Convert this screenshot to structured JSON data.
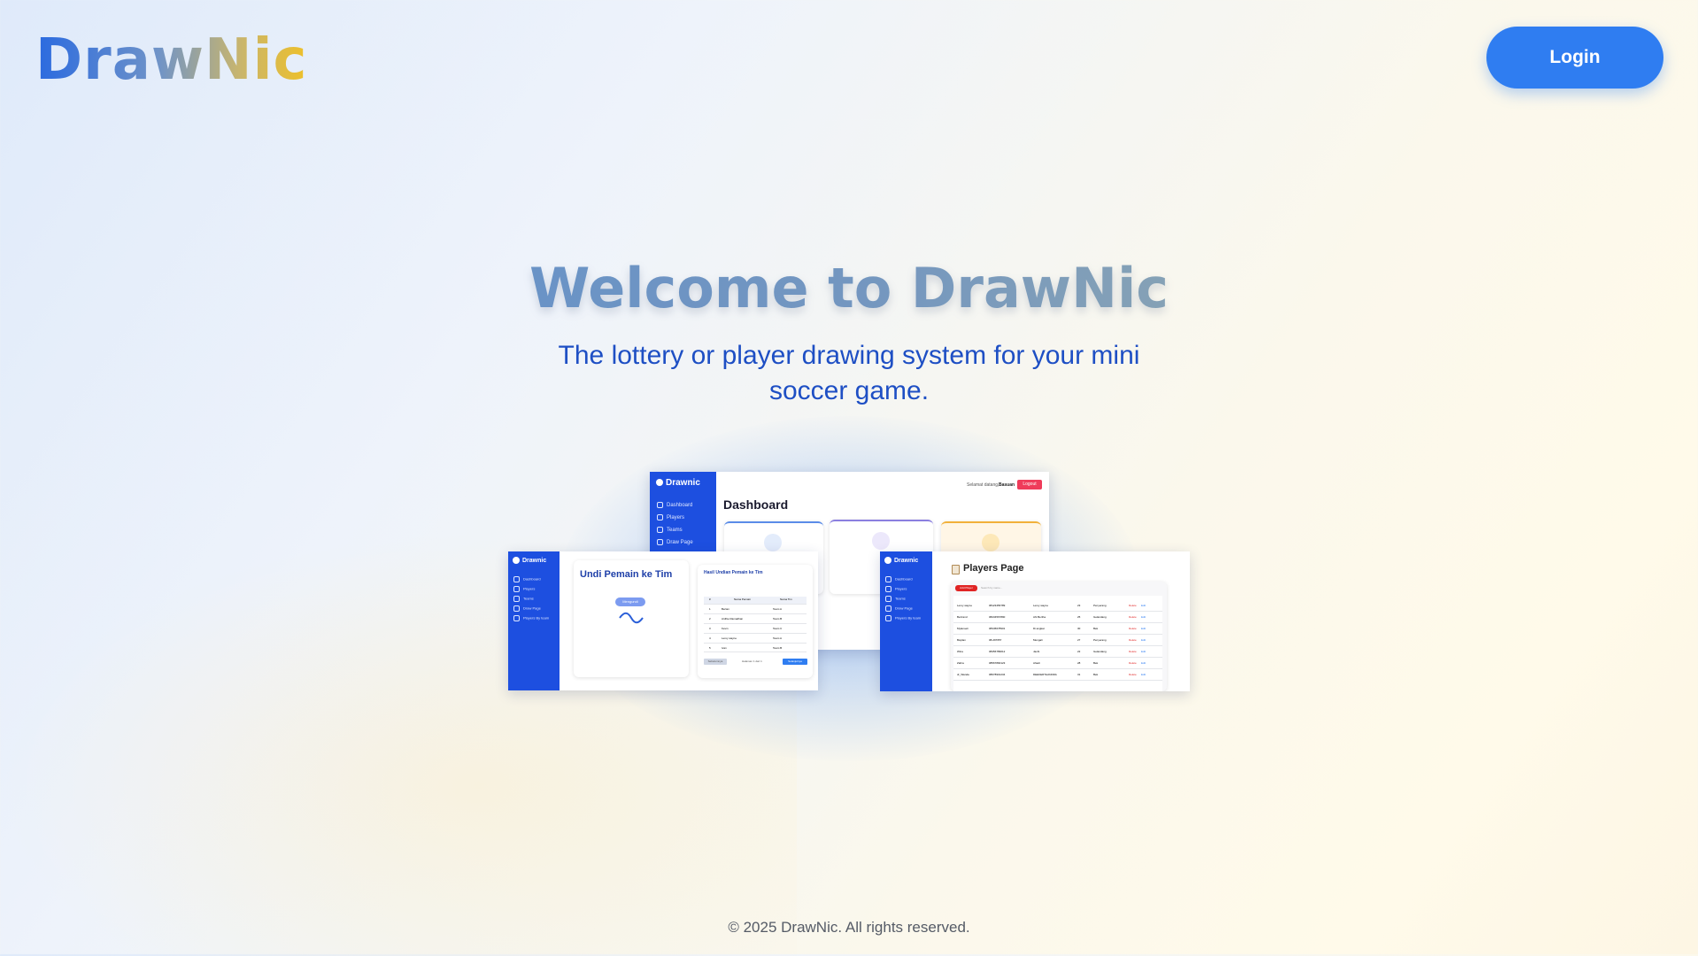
{
  "header": {
    "logo": "DrawNic",
    "login_label": "Login"
  },
  "hero": {
    "title": "Welcome to DrawNic",
    "subtitle": "The lottery or player drawing system for your mini soccer game."
  },
  "preview": {
    "brand": "Drawnic",
    "dashboard": {
      "title": "Dashboard",
      "greeting_prefix": "Selamat datang,",
      "greeting_name": "Basuan",
      "logout_label": "Logout",
      "nav": [
        "Dashboard",
        "Players",
        "Teams",
        "Draw Page"
      ]
    },
    "draw": {
      "nav": [
        "Dashboard",
        "Players",
        "Teams",
        "Draw Page",
        "Players By team"
      ],
      "card_title": "Undi Pemain ke Tim",
      "button_label": "Mengundi",
      "result_title": "Hasil Undian Pemain ke Tim",
      "columns": [
        "#",
        "Nama Pemain",
        "Nama Tim"
      ],
      "rows": [
        [
          "1",
          "Bertan",
          "Team A"
        ],
        [
          "2",
          "Ardhie Ramadhan",
          "Team B"
        ],
        [
          "3",
          "Kevin",
          "Team C"
        ],
        [
          "4",
          "Leroy wayne",
          "Team A"
        ],
        [
          "5",
          "Ivan",
          "Team B"
        ]
      ],
      "prev_label": "Sebelumnya",
      "page_label": "Halaman 1 dari 1",
      "next_label": "Selanjutnya"
    },
    "players": {
      "nav": [
        "Dashboard",
        "Players",
        "Teams",
        "Draw Page",
        "Players By team"
      ],
      "title": "Players Page",
      "add_label": "Add Player",
      "search_placeholder": "Search by name...",
      "rows": [
        [
          "Leroy wayne",
          "08123456789",
          "Leroy wayne",
          "23",
          "Penyerang"
        ],
        [
          "Bertrand",
          "08234567890",
          "Ahi Bertha",
          "25",
          "Gelandang"
        ],
        [
          "Mylanoeli",
          "08345678901",
          "Di angkat",
          "30",
          "Bek"
        ],
        [
          "Baylian",
          "08-297657",
          "Mengali",
          "27",
          "Penyerang"
        ],
        [
          "Wina",
          "08456789012",
          "Jauhi",
          "22",
          "Gelandang"
        ],
        [
          "Zahra",
          "08567890123",
          "Ahadi",
          "28",
          "Bek"
        ],
        [
          "dr_Wanda",
          "08678901234",
          "DEEKERTHANDRA",
          "31",
          "Bek"
        ]
      ],
      "action_delete": "Delete",
      "action_edit": "Edit"
    }
  },
  "footer": {
    "copyright": "© 2025 DrawNic. All rights reserved."
  },
  "colors": {
    "primary": "#2f7df1",
    "sidebar": "#1d4fe0",
    "subtitle": "#1e4fc4"
  }
}
